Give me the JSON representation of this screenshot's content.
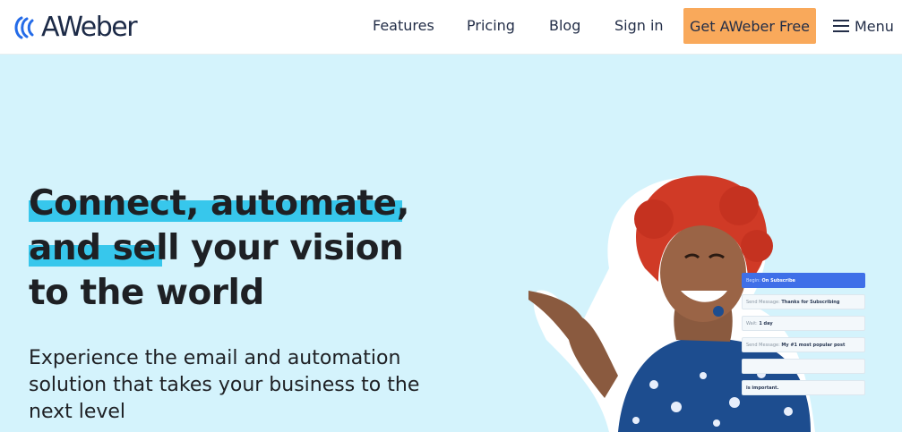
{
  "brand": {
    "name": "AWeber",
    "colors": {
      "primary": "#246be8",
      "dark": "#1c2a47",
      "accent": "#f9a95b",
      "highlight": "#37c7ec",
      "hero_bg": "#d4f3fc"
    }
  },
  "nav": {
    "features": "Features",
    "pricing": "Pricing",
    "blog": "Blog",
    "signin": "Sign in",
    "cta": "Get AWeber Free",
    "menu": "Menu"
  },
  "hero": {
    "headline_line1": "Connect, automate,",
    "headline_line2": "and sell your vision",
    "headline_line3": "to the world",
    "subtext": "Experience the email and automation solution that takes your business to the next level"
  },
  "workflow": {
    "steps": [
      {
        "prefix": "Begin:",
        "value": "On Subscribe"
      },
      {
        "prefix": "Send Message:",
        "value": "Thanks for Subscribing"
      },
      {
        "prefix": "Wait:",
        "value": "1 day"
      },
      {
        "prefix": "Send Message:",
        "value": "My #1 most popular post"
      },
      {
        "prefix": "",
        "value": ""
      },
      {
        "prefix": "",
        "value": "is important."
      }
    ]
  },
  "icons": [
    "aweber-logo-icon",
    "hamburger-menu-icon"
  ]
}
